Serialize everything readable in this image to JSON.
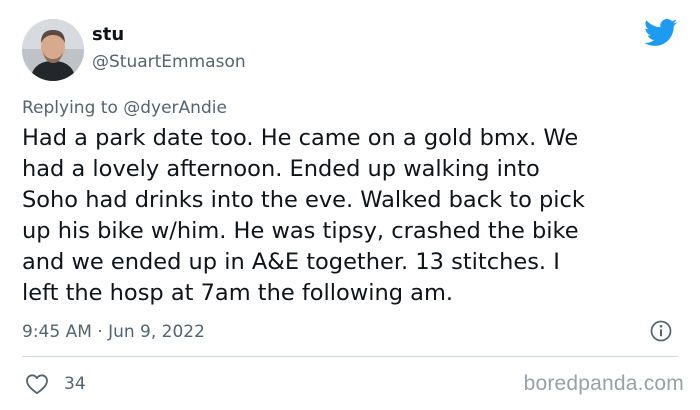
{
  "tweet": {
    "author": {
      "display_name": "stu",
      "handle": "@StuartEmmason"
    },
    "reply": {
      "prefix": "Replying to",
      "to_handle": "@dyerAndie"
    },
    "text": "Had a park date too. He came on a gold bmx. We\nhad a lovely afternoon. Ended up walking into\nSoho had drinks into the eve. Walked back to pick\nup his bike w/him. He was tipsy, crashed the bike\nand we ended up in A&E together. 13 stitches. I\nleft the hosp at 7am the following am.",
    "timestamp": "9:45 AM · Jun 9, 2022",
    "like_count": "34",
    "icons": {
      "brand": "twitter-bird-icon",
      "info": "info-icon",
      "like": "heart-icon"
    }
  },
  "watermark": "boredpanda.com",
  "colors": {
    "twitter_blue": "#1d9bf0",
    "muted_text": "#536471",
    "primary_text": "#0f1419",
    "divider": "#cfd9de"
  }
}
